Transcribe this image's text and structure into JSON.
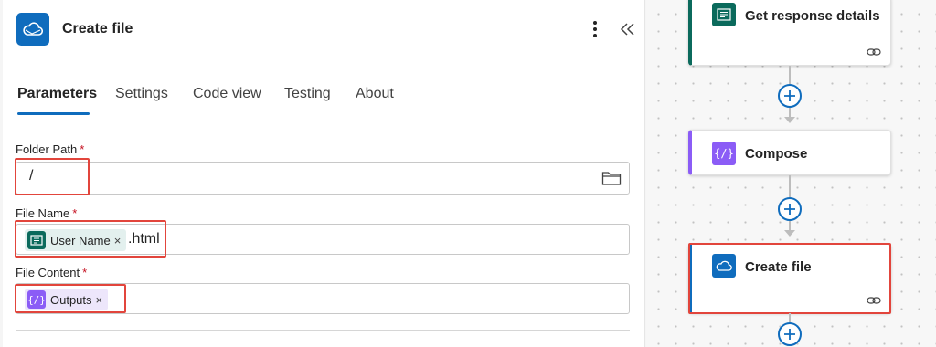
{
  "panel": {
    "title": "Create file",
    "tabs": [
      "Parameters",
      "Settings",
      "Code view",
      "Testing",
      "About"
    ],
    "active_tab": "Parameters"
  },
  "fields": {
    "folder_path": {
      "label": "Folder Path",
      "required_mark": "*",
      "value": "/"
    },
    "file_name": {
      "label": "File Name",
      "required_mark": "*",
      "token_label": "User Name",
      "token_remove": "×",
      "suffix": ".html"
    },
    "file_content": {
      "label": "File Content",
      "required_mark": "*",
      "token_label": "Outputs",
      "token_remove": "×"
    }
  },
  "flow": {
    "cards": [
      {
        "title": "Get response details",
        "icon": "forms-icon"
      },
      {
        "title": "Compose",
        "icon": "compose-icon"
      },
      {
        "title": "Create file",
        "icon": "onedrive-icon"
      }
    ]
  },
  "colors": {
    "accent": "#0f6cbd",
    "forms_green": "#0b6a5c",
    "compose_purple": "#8b5cf6",
    "highlight_red": "#e2453c",
    "required_red": "#c50f1f"
  }
}
